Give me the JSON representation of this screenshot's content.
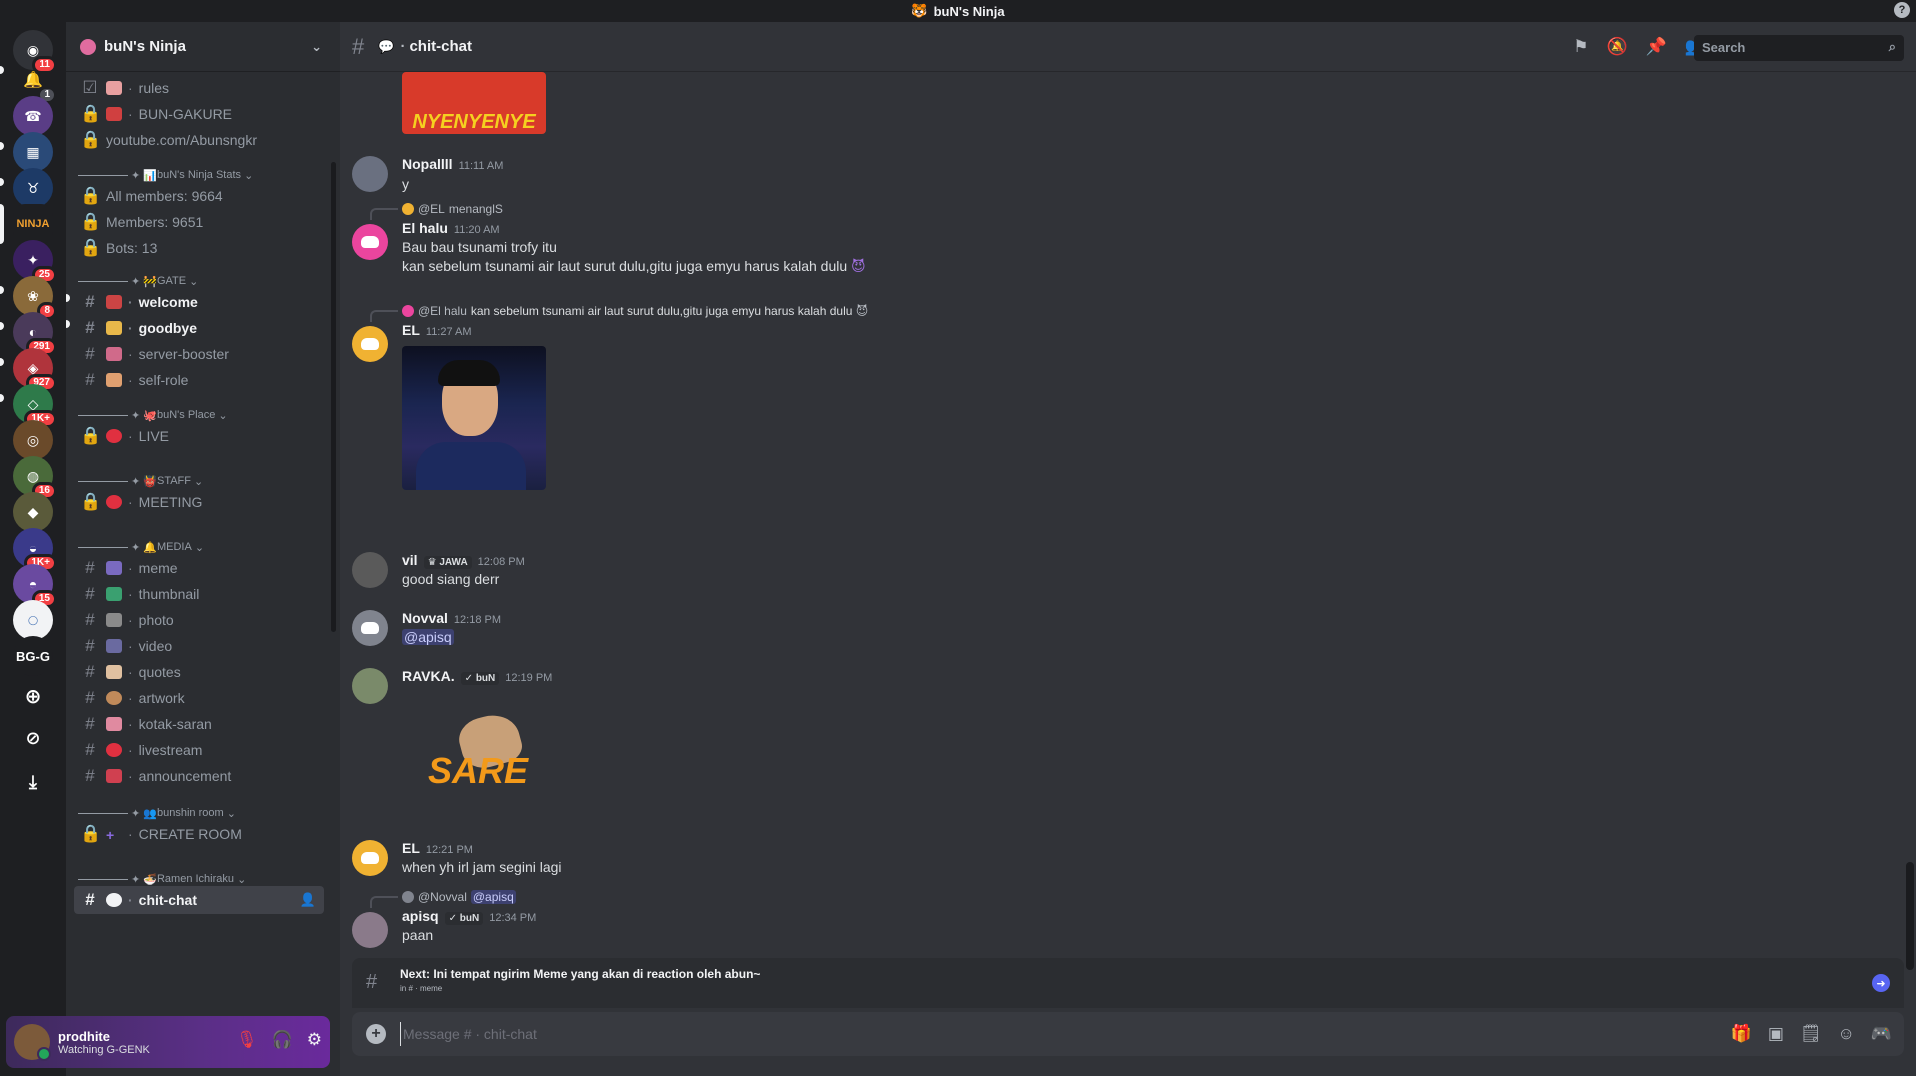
{
  "titlebar": {
    "title": "buN's Ninja",
    "help": "?"
  },
  "rail": {
    "badges": [
      "11",
      "1",
      "25",
      "8",
      "291",
      "927",
      "1K+",
      "16",
      "1K+",
      "15"
    ],
    "text_server": "BG-G"
  },
  "guild": {
    "name": "buN's Ninja"
  },
  "channels": {
    "rules": "rules",
    "bun_gakure": "BUN-GAKURE",
    "youtube": "youtube.com/Abunsngkr",
    "cat_stats": "buN's Ninja Stats",
    "all_members": "All members: 9664",
    "members": "Members: 9651",
    "bots": "Bots: 13",
    "cat_gate": "GATE",
    "welcome": "welcome",
    "goodbye": "goodbye",
    "server_booster": "server-booster",
    "self_role": "self-role",
    "cat_place": "buN's Place",
    "live": "LIVE",
    "cat_staff": "STAFF",
    "meeting": "MEETING",
    "cat_media": "MEDIA",
    "meme": "meme",
    "thumbnail": "thumbnail",
    "photo": "photo",
    "video": "video",
    "quotes": "quotes",
    "artwork": "artwork",
    "kotak_saran": "kotak-saran",
    "livestream": "livestream",
    "announcement": "announcement",
    "cat_bunshin": "bunshin room",
    "create_room": "CREATE ROOM",
    "cat_ramen": "Ramen Ichiraku",
    "chit_chat": "chit-chat"
  },
  "user": {
    "name": "prodhite",
    "status": "Watching G-GENK"
  },
  "header": {
    "channel": "chit-chat",
    "search_placeholder": "Search"
  },
  "messages": {
    "m1": {
      "image_text": "NYENYENYE"
    },
    "m2": {
      "user": "Nopallll",
      "time": "11:11 AM",
      "text": "y"
    },
    "m3": {
      "reply_user": "@EL",
      "reply_text": "menanglS",
      "user": "El halu",
      "time": "11:20 AM",
      "line1": "Bau bau tsunami trofy itu",
      "line2": "kan sebelum tsunami air laut  surut dulu,gitu juga emyu harus kalah dulu"
    },
    "m4": {
      "reply_user": "@El halu",
      "reply_text": "kan sebelum tsunami air laut  surut dulu,gitu juga emyu harus kalah dulu",
      "user": "EL",
      "time": "11:27 AM"
    },
    "m5": {
      "user": "vil",
      "tag": "JAWA",
      "time": "12:08 PM",
      "text": "good siang derr"
    },
    "m6": {
      "user": "Novval",
      "time": "12:18 PM",
      "mention": "@apisq"
    },
    "m7": {
      "user": "RAVKA.",
      "tag": "buN",
      "time": "12:19 PM",
      "sticker_text": "SARE"
    },
    "m8": {
      "user": "EL",
      "time": "12:21 PM",
      "text": "when yh irl jam segini lagi"
    },
    "m9": {
      "reply_user": "@Novval",
      "reply_mention": "@apisq",
      "user": "apisq",
      "tag": "buN",
      "time": "12:34 PM",
      "text": "paan"
    }
  },
  "next": {
    "title": "Next: Ini tempat ngirim Meme yang akan di reaction oleh abun~",
    "sub": "in # · meme"
  },
  "composer": {
    "placeholder": "Message # · chit-chat"
  },
  "colors": {
    "accent": "#5865f2",
    "danger": "#f23f43",
    "online": "#23a55a"
  }
}
